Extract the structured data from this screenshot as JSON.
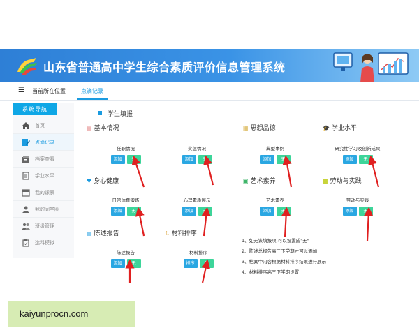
{
  "banner": {
    "title": "山东省普通高中学生综合素质评价信息管理系统"
  },
  "breadcrumb": {
    "label": "当前所在位置",
    "current": "点滴记录"
  },
  "sidebar": {
    "header": "系统导航",
    "items": [
      {
        "label": "首页",
        "icon": "home-icon"
      },
      {
        "label": "点滴记录",
        "icon": "edit-icon"
      },
      {
        "label": "档案查看",
        "icon": "archive-icon"
      },
      {
        "label": "学业水平",
        "icon": "document-icon"
      },
      {
        "label": "我的课表",
        "icon": "calendar-icon"
      },
      {
        "label": "我的同学圈",
        "icon": "users-icon"
      },
      {
        "label": "班级管理",
        "icon": "group-icon"
      },
      {
        "label": "选科模拟",
        "icon": "clipboard-icon"
      }
    ]
  },
  "main": {
    "title": "学生填报",
    "buttons": {
      "add": "添加",
      "none": "无",
      "sort": "排序"
    },
    "sections": {
      "basic": {
        "title": "基本情况",
        "fields": [
          "任职情况",
          "奖惩情况"
        ]
      },
      "moral": {
        "title": "思想品德",
        "fields": [
          "典型事例"
        ]
      },
      "academic": {
        "title": "学业水平",
        "fields": [
          "研究性学习及创新成果"
        ]
      },
      "health": {
        "title": "身心健康",
        "fields": [
          "日常体育锻炼",
          "心理素质展示"
        ]
      },
      "art": {
        "title": "艺术素养",
        "fields": [
          "艺术素养"
        ]
      },
      "labor": {
        "title": "劳动与实践",
        "fields": [
          "劳动与实践"
        ]
      },
      "report": {
        "title": "陈述报告",
        "fields": [
          "陈述报告"
        ]
      },
      "materials": {
        "title": "材料排序",
        "fields": [
          "材料排序"
        ]
      }
    },
    "notes": [
      "1、如无该填报项,可以设置成\"无\"",
      "2、陈述总报告高三下学期才可以添加",
      "3、档案中内容根据材料排序结果进行展示",
      "4、材料排序高三下学期设置"
    ]
  },
  "watermark": "kaiyunprocn.com",
  "colors": {
    "banner": "#2e7fd6",
    "accent": "#1a9be0",
    "add_button": "#2aa7e2",
    "none_button": "#3dd59a",
    "arrow": "#e02020"
  }
}
